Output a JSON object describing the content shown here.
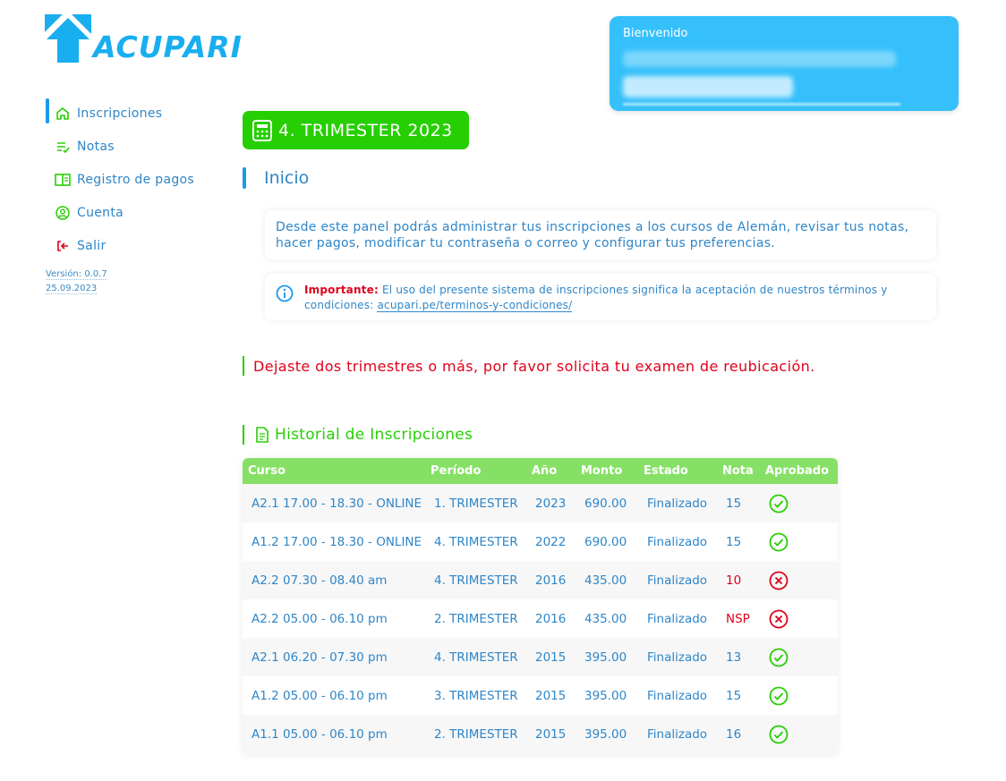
{
  "logo": {
    "text": "ACUPARI"
  },
  "sidebar": {
    "items": [
      {
        "label": "Inscripciones",
        "icon": "home-icon",
        "active": true
      },
      {
        "label": "Notas",
        "icon": "list-check-icon",
        "active": false
      },
      {
        "label": "Registro de pagos",
        "icon": "book-icon",
        "active": false
      },
      {
        "label": "Cuenta",
        "icon": "user-circle-icon",
        "active": false
      },
      {
        "label": "Salir",
        "icon": "logout-icon",
        "active": false
      }
    ],
    "version": "Versión: 0.0.7",
    "date": "25.09.2023"
  },
  "welcome": {
    "title": "Bienvenido"
  },
  "trimester": {
    "label": "4. TRIMESTER 2023"
  },
  "inicio": {
    "title": "Inicio",
    "description": "Desde este panel podrás administrar tus inscripciones a los cursos de Alemán, revisar tus notas, hacer pagos, modificar tu contraseña o correo y configurar tus preferencias.",
    "important_label": "Importante:",
    "important_text": "El uso del presente sistema de inscripciones significa la aceptación de nuestros términos y condiciones:",
    "important_link": "acupari.pe/terminos-y-condiciones/"
  },
  "warning": "Dejaste dos trimestres o más, por favor solicita tu examen de reubicación.",
  "history": {
    "title": "Historial de Inscripciones",
    "columns": [
      "Curso",
      "Período",
      "Año",
      "Monto",
      "Estado",
      "Nota",
      "Aprobado"
    ],
    "rows": [
      {
        "curso": "A2.1 17.00 - 18.30 - ONLINE",
        "periodo": "1. TRIMESTER",
        "anio": "2023",
        "monto": "690.00",
        "estado": "Finalizado",
        "nota": "15",
        "aprobado": true
      },
      {
        "curso": "A1.2 17.00 - 18.30 - ONLINE",
        "periodo": "4. TRIMESTER",
        "anio": "2022",
        "monto": "690.00",
        "estado": "Finalizado",
        "nota": "15",
        "aprobado": true
      },
      {
        "curso": "A2.2 07.30 - 08.40 am",
        "periodo": "4. TRIMESTER",
        "anio": "2016",
        "monto": "435.00",
        "estado": "Finalizado",
        "nota": "10",
        "aprobado": false
      },
      {
        "curso": "A2.2 05.00 - 06.10 pm",
        "periodo": "2. TRIMESTER",
        "anio": "2016",
        "monto": "435.00",
        "estado": "Finalizado",
        "nota": "NSP",
        "aprobado": false
      },
      {
        "curso": "A2.1 06.20 - 07.30 pm",
        "periodo": "4. TRIMESTER",
        "anio": "2015",
        "monto": "395.00",
        "estado": "Finalizado",
        "nota": "13",
        "aprobado": true
      },
      {
        "curso": "A1.2 05.00 - 06.10 pm",
        "periodo": "3. TRIMESTER",
        "anio": "2015",
        "monto": "395.00",
        "estado": "Finalizado",
        "nota": "15",
        "aprobado": true
      },
      {
        "curso": "A1.1 05.00 - 06.10 pm",
        "periodo": "2. TRIMESTER",
        "anio": "2015",
        "monto": "395.00",
        "estado": "Finalizado",
        "nota": "16",
        "aprobado": true
      }
    ]
  },
  "colors": {
    "accent_blue": "#1a9ae8",
    "green": "#26cf02",
    "header_green": "#86e066",
    "red": "#e0001b",
    "welcome_bg": "#35c0fb"
  }
}
